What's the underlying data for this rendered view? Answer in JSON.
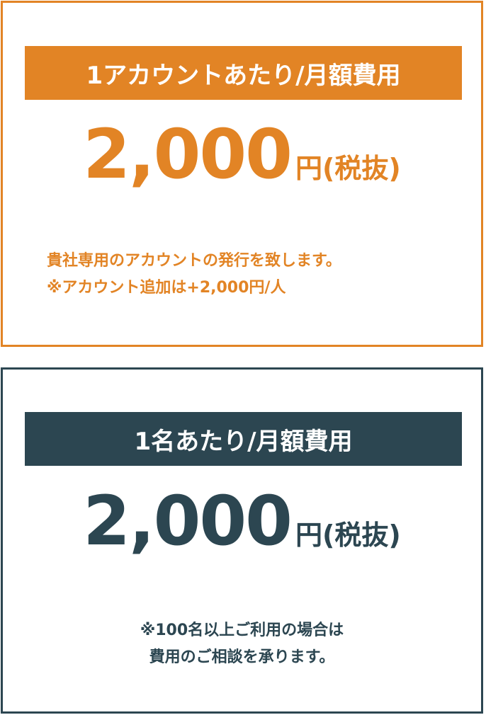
{
  "colors": {
    "orange": "#e28425",
    "navy": "#2c4651",
    "background": "#ffffff"
  },
  "plan_account": {
    "banner": "1アカウントあたり/月額費用",
    "amount": "2,000",
    "unit": "円(税抜)",
    "note_lines": [
      "貴社専用のアカウントの発行を致します。",
      "※アカウント追加は+2,000円/人"
    ]
  },
  "plan_person": {
    "banner": "1名あたり/月額費用",
    "amount": "2,000",
    "unit": "円(税抜)",
    "note_lines": [
      "※100名以上ご利用の場合は",
      "費用のご相談を承ります。"
    ]
  }
}
